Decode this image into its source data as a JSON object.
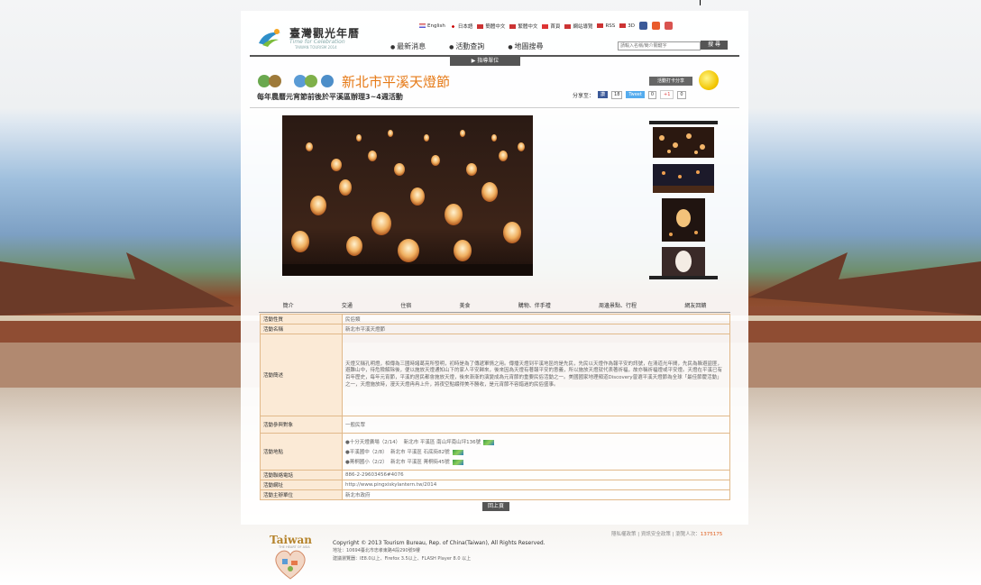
{
  "site": {
    "title": "臺灣觀光年曆",
    "subtitle": "Time for Celebration",
    "subtitle2": "TAIWAN TOURISM 2014"
  },
  "langbar": [
    "English",
    "日本語",
    "簡體中文",
    "繁體中文",
    "首頁",
    "網站導覽",
    "RSS",
    "3D"
  ],
  "nav": [
    "最新消息",
    "活動查詢",
    "地圖搜尋"
  ],
  "search": {
    "placeholder": "請輸入名稱/簡介關鍵字",
    "button": "搜 尋"
  },
  "guide_button": "指導單位",
  "event": {
    "title": "新北市平溪天燈節",
    "subtitle": "每年農曆元宵節前後於平溪區辦理3~4週活動",
    "award_button": "活動打卡分享",
    "share_label": "分享至：",
    "share": [
      {
        "label": "讚",
        "count": "18"
      },
      {
        "label": "Tweet",
        "count": "0"
      },
      {
        "label": "+1",
        "count": "0"
      }
    ]
  },
  "tabs": [
    "簡介",
    "交通",
    "住宿",
    "美食",
    "購物、伴手禮",
    "周邊景點、行程",
    "網友回饋"
  ],
  "info": {
    "type_label": "活動性質",
    "type_value": "民俗類",
    "name_label": "活動名稱",
    "name_value": "新北市平溪天燈節",
    "desc_label": "活動簡述",
    "desc_value": "天燈又稱孔明燈，相傳為三國時諸葛亮所發明，初時是為了傳遞軍情之用。傳播天燈到平溪地區的是先民，先民以天燈作為報平安的訊號，在清道光年間，先民為躲避盜匪，避難山中，待危險解除後，便以施放天燈通知山下的家人平安歸來，後來因為天燈有著報平安的意義，所以施放天燈就代表著祈福，故亦稱祈福燈或平安燈。天燈在平溪已有百年歷史，每年元宵節，平溪的居民都會施放天燈，後來漸漸的演變成為元宵節的重要民俗活動之一。美國國家地理頻道Discovery曾選平溪天燈節為全球「最佳節慶活動」之一，天燈施放時，漫天天燈冉冉上升，將夜空點綴得美不勝收，是元宵節不容錯過的民俗盛事。",
    "audience_label": "活動參與對象",
    "audience_value": "一般民眾",
    "place_label": "活動地點",
    "places": [
      {
        "name": "●十分天燈廣場（2/14）",
        "area": "新北市 平溪區",
        "addr": "南山坪南山坪136號"
      },
      {
        "name": "●平溪國中（2/8）",
        "area": "新北市 平溪區",
        "addr": "石底街82號"
      },
      {
        "name": "●菁桐國小（2/2）",
        "area": "新北市 平溪區",
        "addr": "菁桐街45號"
      }
    ],
    "phone_label": "活動聯絡電話",
    "phone_value": "886-2-29603456#4076",
    "web_label": "活動網址",
    "web_value": "http://www.pingxiskylantern.tw/2014",
    "org_label": "活動主辦單位",
    "org_value": "新北市政府"
  },
  "back_button": "回上頁",
  "footer": {
    "logo": "Taiwan",
    "logo_sub": "THE HEART OF ASIA",
    "copyright": "Copyright © 2013 Tourism Bureau, Rep. of China(Taiwan), All Rights Reserved.",
    "address": "地址：10694臺北市忠孝東路4段290號9樓",
    "browser": "建議瀏覽器：IE8.0以上、Firefox 3.5以上、FLASH Player 8.0 以上",
    "stats_label": "隱私權政策 | 資訊安全政策 | 瀏覽人次：",
    "visits": "1375175"
  }
}
